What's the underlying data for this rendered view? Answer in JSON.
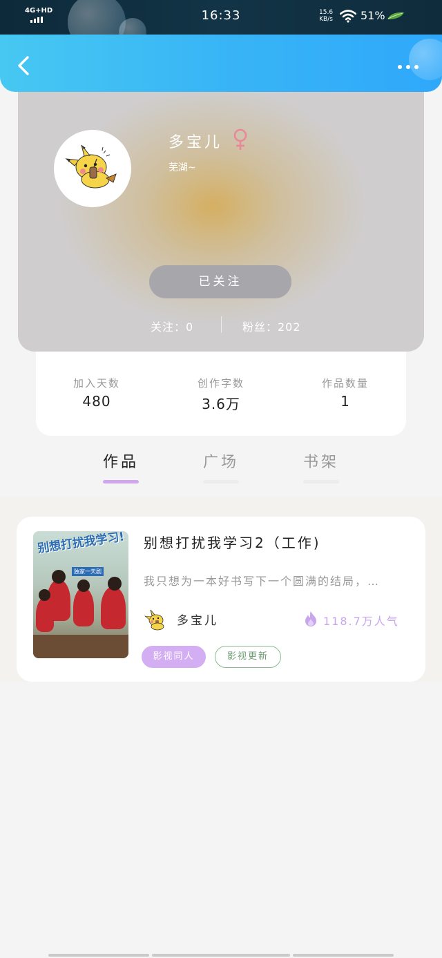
{
  "status_bar": {
    "network": "4G+HD",
    "time": "16:33",
    "speed_value": "15.6",
    "speed_unit": "KB/s",
    "battery": "51%"
  },
  "header": {
    "back_icon": "back-chevron-icon",
    "more_icon": "more-dots-icon"
  },
  "profile": {
    "name": "多宝儿",
    "gender_icon": "female-icon",
    "signature": "芜湖~",
    "follow_button": "已关注",
    "following_label": "关注：0",
    "fans_label": "粉丝：202",
    "accent_color": "#e8889a"
  },
  "stats": [
    {
      "label": "加入天数",
      "value": "480"
    },
    {
      "label": "创作字数",
      "value": "3.6万"
    },
    {
      "label": "作品数量",
      "value": "1"
    }
  ],
  "tabs": [
    {
      "label": "作品",
      "active": true
    },
    {
      "label": "广场",
      "active": false
    },
    {
      "label": "书架",
      "active": false
    }
  ],
  "works": [
    {
      "cover_title": "别想打扰我学习!",
      "cover_subtitle": "独家一天剧",
      "title": "别想打扰我学习2（工作)",
      "description": "我只想为一本好书写下一个圆满的结局，…",
      "author": "多宝儿",
      "popularity_icon": "fire-icon",
      "popularity": "118.7万人气",
      "tags": [
        "影视同人",
        "影视更新"
      ]
    }
  ],
  "colors": {
    "header_blue": "#38b5f6",
    "tab_accent": "#d0a6ee",
    "popularity_purple": "#c9a5ec",
    "tag_green": "#8ab98f"
  }
}
